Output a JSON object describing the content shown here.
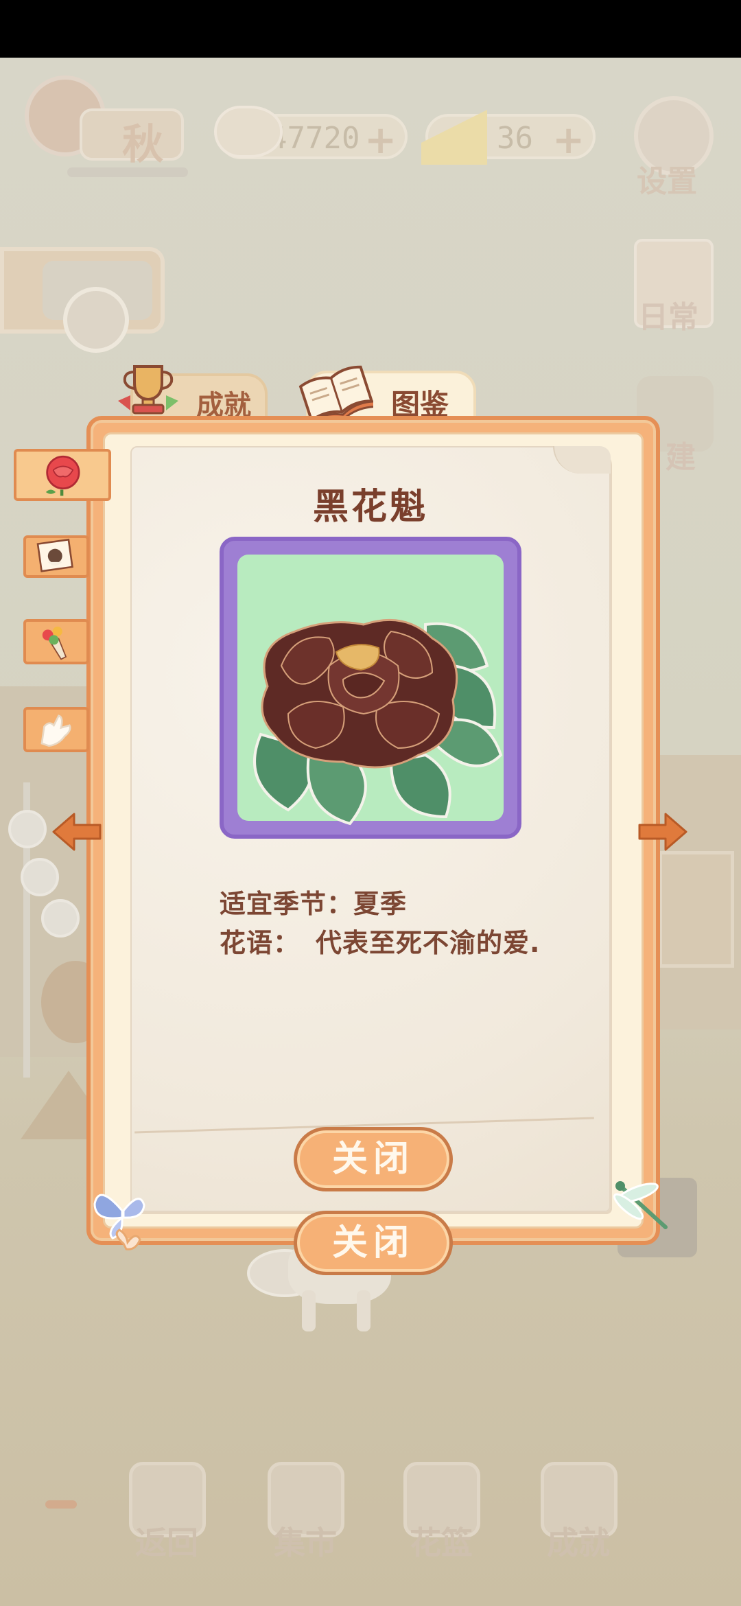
{
  "hud": {
    "season_label": "秋",
    "fish_count": "47720",
    "cheese_count": "36",
    "settings_label": "设置",
    "daily_label": "日常",
    "build_label": "建"
  },
  "tabs": [
    {
      "label": "成就",
      "icon": "trophy-icon",
      "active": false
    },
    {
      "label": "图鉴",
      "icon": "book-icon",
      "active": true
    }
  ],
  "side_tabs": [
    "rose-icon",
    "cat-photo-icon",
    "bouquet-icon",
    "hand-icon"
  ],
  "flower": {
    "name": "黑花魁",
    "season_key": "适宜季节：",
    "season_value": "夏季",
    "language_key": "花语：",
    "language_value": "代表至死不渝的爱."
  },
  "buttons": {
    "close_primary": "关闭",
    "close_secondary": "关闭"
  },
  "dock": [
    "返回",
    "集市",
    "花篮",
    "成就"
  ],
  "colors": {
    "frame": "#f5b27a",
    "frame_border": "#e58f55",
    "card_border": "#8a66c6",
    "card_bg": "#b8ebbf",
    "text": "#7a3f2c"
  }
}
